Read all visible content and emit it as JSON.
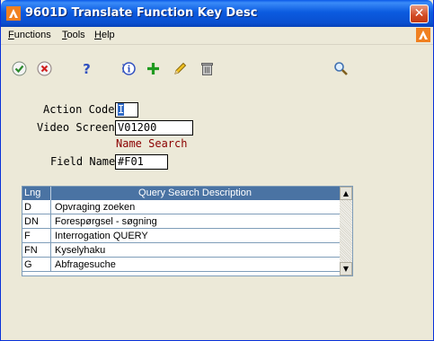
{
  "window": {
    "title": "9601D   Translate Function Key Desc"
  },
  "menu": {
    "items": [
      {
        "label": "Functions",
        "ul": "F",
        "rest": "unctions"
      },
      {
        "label": "Tools",
        "ul": "T",
        "rest": "ools"
      },
      {
        "label": "Help",
        "ul": "H",
        "rest": "elp"
      }
    ]
  },
  "toolbar": {
    "icons": [
      "ok-check-icon",
      "cancel-x-icon",
      "help-question-icon",
      "info-icon",
      "add-plus-icon",
      "edit-pencil-icon",
      "delete-trash-icon",
      "search-magnifier-icon"
    ]
  },
  "form": {
    "action_code_label": "Action Code",
    "action_code_value": "I",
    "video_screen_label": "Video Screen",
    "video_screen_value": "V01200",
    "video_screen_desc": "Name Search",
    "field_name_label": "Field Name",
    "field_name_value": "#F01"
  },
  "grid": {
    "columns": [
      "Lng",
      "Query Search Description"
    ],
    "rows": [
      {
        "lng": "D",
        "desc": "Opvraging zoeken"
      },
      {
        "lng": "DN",
        "desc": "Forespørgsel - søgning"
      },
      {
        "lng": "F",
        "desc": "Interrogation QUERY"
      },
      {
        "lng": "FN",
        "desc": "Kyselyhaku"
      },
      {
        "lng": "G",
        "desc": "Abfragesuche"
      }
    ]
  },
  "colors": {
    "title_bar": "#0a58e8",
    "grid_header": "#4a73a3",
    "desc_text": "#8b0000"
  }
}
